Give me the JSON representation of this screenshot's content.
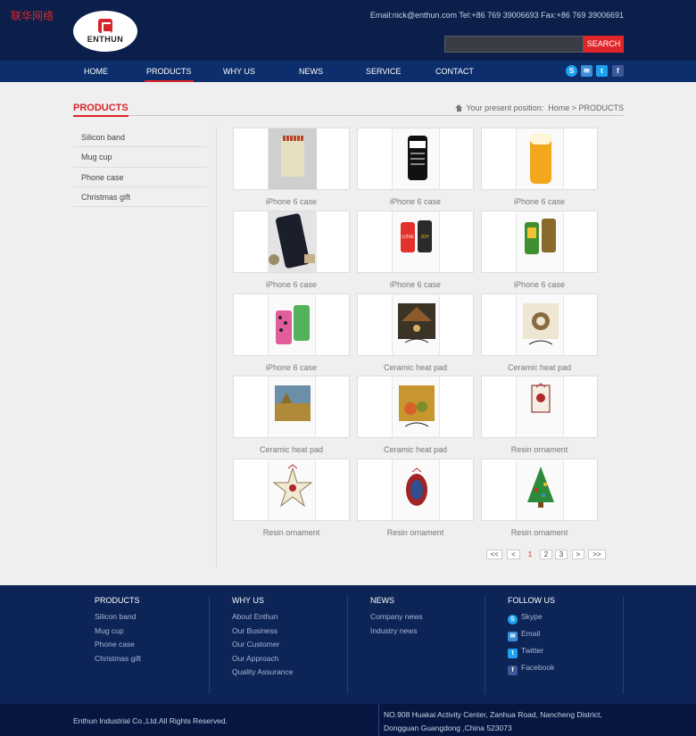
{
  "header": {
    "brand_cn": "联华网络",
    "logo_text": "ENTHUN",
    "contact": "Email:nick@enthun.com  Tel:+86 769 39006693  Fax:+86 769 39006691",
    "search_placeholder": "",
    "search_label": "SEARCH"
  },
  "nav": {
    "items": [
      {
        "label": "HOME"
      },
      {
        "label": "PRODUCTS"
      },
      {
        "label": "WHY US"
      },
      {
        "label": "NEWS"
      },
      {
        "label": "SERVICE"
      },
      {
        "label": "CONTACT"
      }
    ],
    "active": "PRODUCTS",
    "social": [
      {
        "icon": "skype-icon",
        "glyph": "S",
        "color": "#1da1f2"
      },
      {
        "icon": "email-icon",
        "glyph": "✉",
        "color": "#3b8ed9"
      },
      {
        "icon": "twitter-icon",
        "glyph": "t",
        "color": "#1da1f2"
      },
      {
        "icon": "facebook-icon",
        "glyph": "f",
        "color": "#3b5998"
      }
    ]
  },
  "page": {
    "title": "PRODUCTS",
    "breadcrumb_prefix": "Your present position:",
    "breadcrumb_path": "Home > PRODUCTS"
  },
  "sidebar": {
    "items": [
      {
        "label": "Silicon band"
      },
      {
        "label": "Mug cup"
      },
      {
        "label": "Phone case"
      },
      {
        "label": "Christmas gift"
      }
    ]
  },
  "products": [
    {
      "label": "iPhone 6 case",
      "thumb": "matches"
    },
    {
      "label": "iPhone 6 case",
      "thumb": "clapper"
    },
    {
      "label": "iPhone 6 case",
      "thumb": "beer"
    },
    {
      "label": "iPhone 6 case",
      "thumb": "black-case"
    },
    {
      "label": "iPhone 6 case",
      "thumb": "love-cases"
    },
    {
      "label": "iPhone 6 case",
      "thumb": "green-cases"
    },
    {
      "label": "iPhone 6 case",
      "thumb": "pink-cases"
    },
    {
      "label": "Ceramic heat pad",
      "thumb": "nativity"
    },
    {
      "label": "Ceramic heat pad",
      "thumb": "damask"
    },
    {
      "label": "Ceramic heat pad",
      "thumb": "landscape"
    },
    {
      "label": "Ceramic heat pad",
      "thumb": "harvest"
    },
    {
      "label": "Resin ornament",
      "thumb": "ornament-rect"
    },
    {
      "label": "Resin ornament",
      "thumb": "ornament-star"
    },
    {
      "label": "Resin ornament",
      "thumb": "ornament-oval"
    },
    {
      "label": "Resin ornament",
      "thumb": "ornament-tree"
    }
  ],
  "pager": {
    "first": "<<",
    "prev": "<",
    "pages": [
      "1",
      "2",
      "3"
    ],
    "current": "1",
    "next": ">",
    "last": ">>"
  },
  "footer": {
    "columns": [
      {
        "title": "PRODUCTS",
        "links": [
          "Silicon band",
          "Mug cup",
          "Phone case",
          "Christmas gift"
        ]
      },
      {
        "title": "WHY US",
        "links": [
          "About Enthun",
          "Our Business",
          "Our Customer",
          "Our Approach",
          "Quality Assurance"
        ]
      },
      {
        "title": "NEWS",
        "links": [
          "Company news",
          "Industry news"
        ]
      }
    ],
    "follow": {
      "title": "FOLLOW US",
      "links": [
        {
          "label": "Skype",
          "icon": "skype-icon",
          "glyph": "S",
          "color": "#1da1f2"
        },
        {
          "label": "Email",
          "icon": "email-icon",
          "glyph": "✉",
          "color": "#3b8ed9"
        },
        {
          "label": "Twitter",
          "icon": "twitter-icon",
          "glyph": "t",
          "color": "#1da1f2"
        },
        {
          "label": "Facebook",
          "icon": "facebook-icon",
          "glyph": "f",
          "color": "#3b5998"
        }
      ]
    },
    "copyright": "Enthun Industrial Co.,Ltd.All Rights Reserved.",
    "address": "NO.908 Huakai Activity Center, Zanhua Road, Nancheng District, Dongguan Guangdong ,China 523073"
  },
  "colors": {
    "accent": "#e0262b",
    "header_bg": "#0b1f4a",
    "nav_bg": "#0d2e6c",
    "footer_bg": "#0d2456"
  }
}
